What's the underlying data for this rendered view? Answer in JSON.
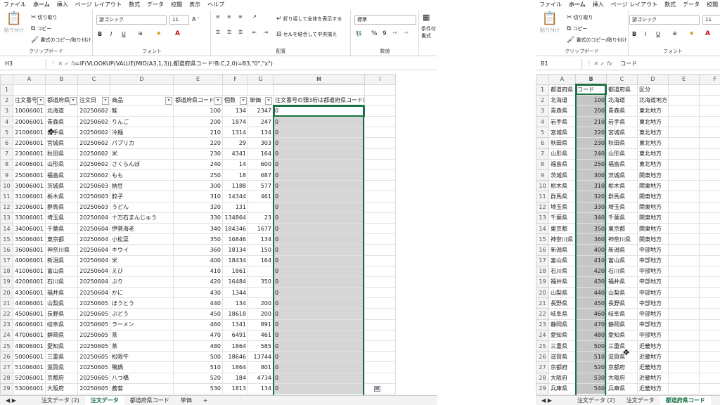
{
  "menu": [
    "ファイル",
    "ホーム",
    "挿入",
    "ページ レイアウト",
    "数式",
    "データ",
    "校閲",
    "表示",
    "ヘルプ"
  ],
  "ribbon": {
    "paste": "貼り付け",
    "cut": "切り取り",
    "copy": "コピー",
    "format_painter": "書式のコピー/貼り付け",
    "clipboard": "クリップボード",
    "font_name": "游ゴシック",
    "font_size": "11",
    "bold": "B",
    "italic": "I",
    "underline": "U",
    "font": "フォント",
    "wrap": "折り返して全体を表示する",
    "merge": "セルを結合して中央揃え",
    "align": "配置",
    "number_format": "標準",
    "percent": "%",
    "comma": "9",
    "number": "数値",
    "cond_format_1": "条件付",
    "cond_format_2": "書式"
  },
  "left": {
    "name_box": "H3",
    "fx": "fx",
    "formula": "=IF(VLOOKUP(VALUE(MID(A3,1,3)),都道府県コード!B:C,2,0)=B3,\"0\",\"x\")",
    "col_headers": [
      "A",
      "B",
      "C",
      "D",
      "E",
      "F",
      "G",
      "H",
      "I"
    ],
    "header_row": [
      "注文番号",
      "都道府県",
      "注文日",
      "商品",
      "都道府県コード",
      "個数",
      "単価",
      "注文番号の頭3桁は都道府県コードは合っているか",
      ""
    ],
    "rows": [
      [
        "10006001",
        "北海道",
        "20250602",
        "鮭",
        "100",
        "134",
        "2347",
        "0"
      ],
      [
        "20006001",
        "青森県",
        "20250602",
        "りんご",
        "200",
        "1874",
        "247",
        "0"
      ],
      [
        "21006001",
        "岩手県",
        "20250602",
        "冷麺",
        "210",
        "1314",
        "134",
        "0"
      ],
      [
        "22006001",
        "宮城県",
        "20250602",
        "パプリカ",
        "220",
        "29",
        "303",
        "0"
      ],
      [
        "23006001",
        "秋田県",
        "20250602",
        "米",
        "230",
        "4341",
        "164",
        "0"
      ],
      [
        "24006001",
        "山形県",
        "20250602",
        "さくらんぼ",
        "240",
        "14",
        "600",
        "0"
      ],
      [
        "25006001",
        "福島県",
        "20250602",
        "もも",
        "250",
        "18",
        "687",
        "0"
      ],
      [
        "30006001",
        "茨城県",
        "20250603",
        "納豆",
        "300",
        "1188",
        "577",
        "0"
      ],
      [
        "31006001",
        "栃木県",
        "20250603",
        "餃子",
        "310",
        "14344",
        "461",
        "0"
      ],
      [
        "32006001",
        "群馬県",
        "20250603",
        "うどん",
        "320",
        "131",
        "",
        "0"
      ],
      [
        "33006001",
        "埼玉県",
        "20250604",
        "十万石まんじゅう",
        "330",
        "134864",
        "23",
        "0"
      ],
      [
        "34006001",
        "千葉県",
        "20250604",
        "伊勢海老",
        "340",
        "184346",
        "1677",
        "0"
      ],
      [
        "35006001",
        "東京都",
        "20250604",
        "小松菜",
        "350",
        "16846",
        "134",
        "0"
      ],
      [
        "36006001",
        "神奈川県",
        "20250604",
        "キウイ",
        "360",
        "18134",
        "150",
        "0"
      ],
      [
        "40006001",
        "新潟県",
        "20250604",
        "米",
        "400",
        "18434",
        "164",
        "0"
      ],
      [
        "41006001",
        "富山県",
        "20250604",
        "えび",
        "410",
        "1861",
        "",
        "0"
      ],
      [
        "42006001",
        "石川県",
        "20250604",
        "ぶり",
        "420",
        "16484",
        "350",
        "0"
      ],
      [
        "43006001",
        "福井県",
        "20250604",
        "かに",
        "430",
        "1344",
        "",
        "0"
      ],
      [
        "44006001",
        "山梨県",
        "20250605",
        "ほうとう",
        "440",
        "134",
        "200",
        "0"
      ],
      [
        "45006001",
        "長野県",
        "20250605",
        "ぶどう",
        "450",
        "18618",
        "200",
        "0"
      ],
      [
        "46006001",
        "岐阜県",
        "20250605",
        "ラーメン",
        "460",
        "1341",
        "891",
        "0"
      ],
      [
        "47006001",
        "静岡県",
        "20250605",
        "茶",
        "470",
        "6491",
        "461",
        "0"
      ],
      [
        "48006001",
        "愛知県",
        "20250605",
        "茶",
        "480",
        "1864",
        "585",
        "0"
      ],
      [
        "50006001",
        "三重県",
        "20250605",
        "松阪牛",
        "500",
        "18646",
        "13744",
        "0"
      ],
      [
        "51006001",
        "滋賀県",
        "20250605",
        "鴨鍋",
        "510",
        "1864",
        "801",
        "0"
      ],
      [
        "52006001",
        "京都府",
        "20250605",
        "八つ橋",
        "520",
        "184",
        "4734",
        "0"
      ],
      [
        "53006001",
        "大阪府",
        "20250605",
        "蕎菊",
        "530",
        "1813",
        "134",
        "0"
      ]
    ],
    "tabs": [
      "注文データ (2)",
      "注文データ",
      "都道府県コード",
      "単価",
      "+"
    ],
    "active_tab": "注文データ"
  },
  "right": {
    "name_box": "B1",
    "fx": "fx",
    "formula": "コード",
    "col_headers": [
      "A",
      "B",
      "C",
      "D",
      "E",
      "F"
    ],
    "header_row": [
      "都道府県",
      "コード",
      "都道府県",
      "区分",
      "",
      ""
    ],
    "rows": [
      [
        "北海道",
        "100",
        "北海道",
        "北海道地方"
      ],
      [
        "青森県",
        "200",
        "青森県",
        "東北地方"
      ],
      [
        "岩手県",
        "210",
        "岩手県",
        "東北地方"
      ],
      [
        "宮城県",
        "220",
        "宮城県",
        "東北地方"
      ],
      [
        "秋田県",
        "230",
        "秋田県",
        "東北地方"
      ],
      [
        "山形県",
        "240",
        "山形県",
        "東北地方"
      ],
      [
        "福島県",
        "250",
        "福島県",
        "東北地方"
      ],
      [
        "茨城県",
        "300",
        "茨城県",
        "関東地方"
      ],
      [
        "栃木県",
        "310",
        "栃木県",
        "関東地方"
      ],
      [
        "群馬県",
        "320",
        "群馬県",
        "関東地方"
      ],
      [
        "埼玉県",
        "330",
        "埼玉県",
        "関東地方"
      ],
      [
        "千葉県",
        "340",
        "千葉県",
        "関東地方"
      ],
      [
        "東京都",
        "350",
        "東京都",
        "関東地方"
      ],
      [
        "神奈川県",
        "360",
        "神奈川県",
        "関東地方"
      ],
      [
        "新潟県",
        "400",
        "新潟県",
        "中部地方"
      ],
      [
        "富山県",
        "410",
        "富山県",
        "中部地方"
      ],
      [
        "石川県",
        "420",
        "石川県",
        "中部地方"
      ],
      [
        "福井県",
        "430",
        "福井県",
        "中部地方"
      ],
      [
        "山梨県",
        "440",
        "山梨県",
        "中部地方"
      ],
      [
        "長野県",
        "450",
        "長野県",
        "中部地方"
      ],
      [
        "岐阜県",
        "460",
        "岐阜県",
        "中部地方"
      ],
      [
        "静岡県",
        "470",
        "静岡県",
        "中部地方"
      ],
      [
        "愛知県",
        "480",
        "愛知県",
        "中部地方"
      ],
      [
        "三重県",
        "500",
        "三重県",
        "近畿地方"
      ],
      [
        "滋賀県",
        "510",
        "滋賀県",
        "近畿地方"
      ],
      [
        "京都府",
        "520",
        "京都府",
        "近畿地方"
      ],
      [
        "大阪府",
        "530",
        "大阪府",
        "近畿地方"
      ],
      [
        "兵庫県",
        "540",
        "兵庫県",
        "近畿地方"
      ]
    ],
    "tabs": [
      "注文データ (2)",
      "注文データ",
      "都道府県コード"
    ],
    "active_tab": "都道府県コード"
  },
  "colors": {
    "accent": "#1e7145",
    "selection": "#d6d6d6",
    "header_bg": "#f3f3f3"
  }
}
